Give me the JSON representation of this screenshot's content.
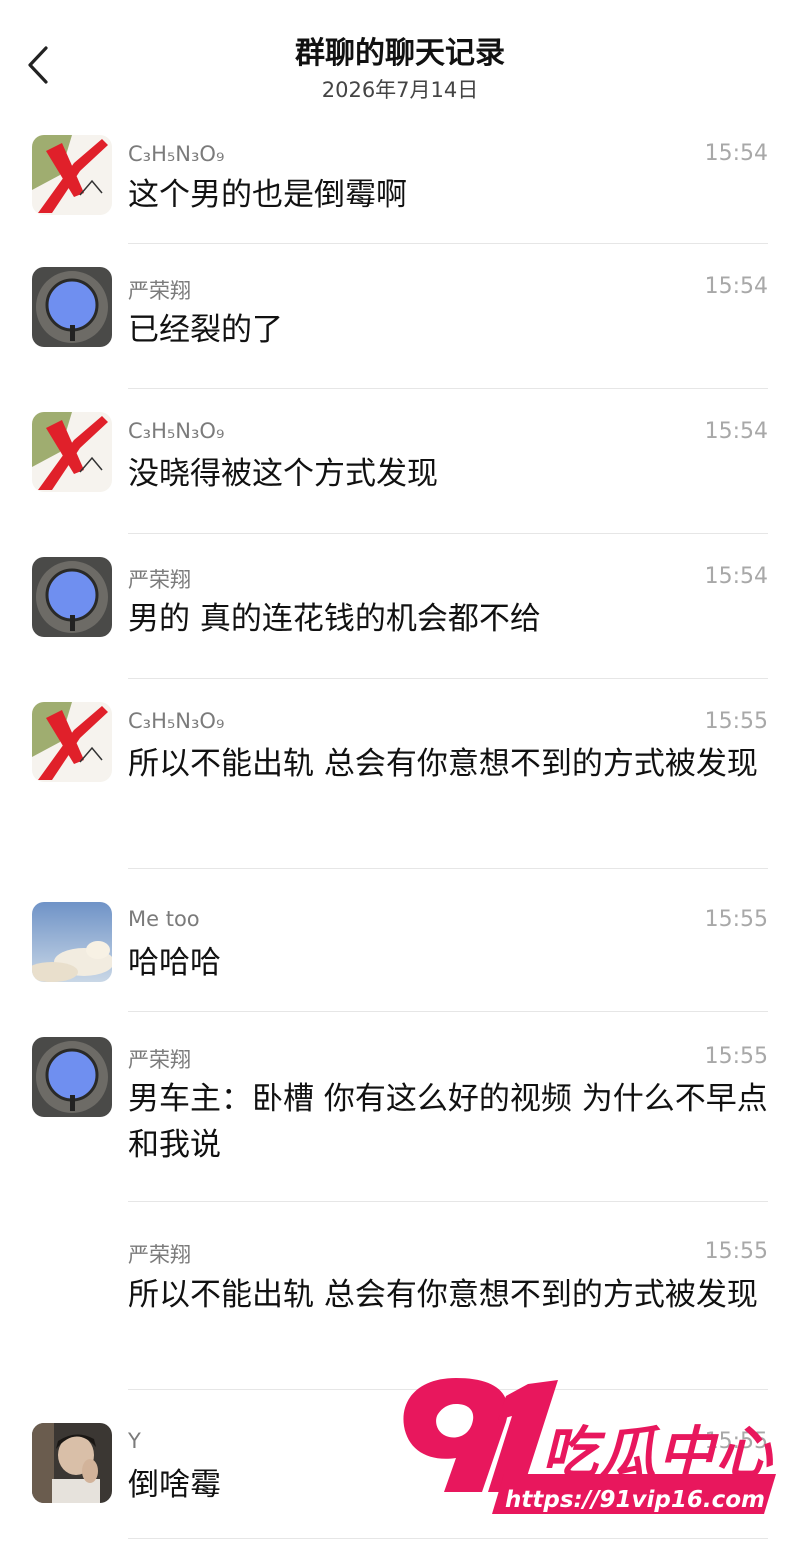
{
  "header": {
    "title": "群聊的聊天记录",
    "date": "2026年7月14日"
  },
  "messages": [
    {
      "sender": "C₃H₅N₃O₉",
      "time": "15:54",
      "text": "这个男的也是倒霉啊",
      "avatar": "red-x-drawing"
    },
    {
      "sender": "严荣翔",
      "time": "15:54",
      "text": "已经裂的了",
      "avatar": "sky-oculus"
    },
    {
      "sender": "C₃H₅N₃O₉",
      "time": "15:54",
      "text": "没晓得被这个方式发现",
      "avatar": "red-x-drawing"
    },
    {
      "sender": "严荣翔",
      "time": "15:54",
      "text": "男的 真的连花钱的机会都不给",
      "avatar": "sky-oculus"
    },
    {
      "sender": "C₃H₅N₃O₉",
      "time": "15:55",
      "text": "所以不能出轨 总会有你意想不到的方式被发现",
      "avatar": "red-x-drawing"
    },
    {
      "sender": "Me too",
      "time": "15:55",
      "text": "哈哈哈",
      "avatar": "cloud-sky"
    },
    {
      "sender": "严荣翔",
      "time": "15:55",
      "text": "男车主：卧槽 你有这么好的视频 为什么不早点和我说",
      "avatar": "sky-oculus"
    },
    {
      "sender": "严荣翔",
      "time": "15:55",
      "text": "所以不能出轨 总会有你意想不到的方式被发现",
      "avatar": ""
    },
    {
      "sender": "Y",
      "time": "15:55",
      "text": "倒啥霉",
      "avatar": "person-portrait"
    }
  ],
  "watermark": {
    "number": "91",
    "name": "吃瓜中心",
    "url": "https://91vip16.com"
  },
  "colors": {
    "watermark": "#e8175d",
    "time": "#a8a8a8",
    "sender": "#7b7b7b"
  }
}
